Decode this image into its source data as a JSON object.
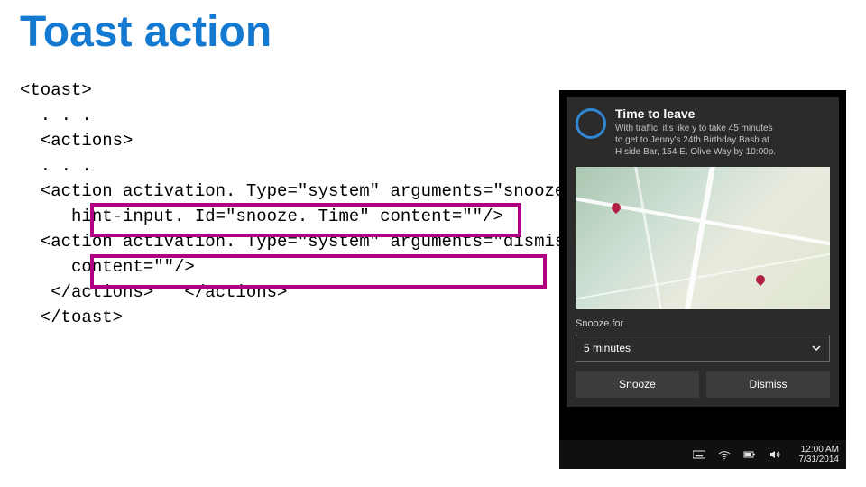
{
  "title": "Toast action",
  "code": {
    "l1": "<toast>",
    "l2": "  . . .",
    "l3": "  <actions>",
    "l4": "  . . .",
    "l5": "  <action activation. Type=\"system\" arguments=\"snooze\"",
    "l6": "     hint-input. Id=\"snooze. Time\" content=\"\"/>",
    "l7": "  <action activation. Type=\"system\" arguments=\"dismiss\"",
    "l8": "     content=\"\"/>",
    "l9": "   </actions>   </actions>",
    "l10": "  </toast>"
  },
  "toast": {
    "title": "Time to leave",
    "body1": "With traffic, it's like y to take 45 minutes",
    "body2": "to get to Jenny's 24th Birthday Bash at",
    "body3": "H side Bar, 154 E. Olive Way by 10:00p.",
    "snooze_label": "Snooze for",
    "snooze_value": "5 minutes",
    "btn_snooze": "Snooze",
    "btn_dismiss": "Dismiss"
  },
  "taskbar": {
    "time": "12:00 AM",
    "date": "7/31/2014"
  }
}
